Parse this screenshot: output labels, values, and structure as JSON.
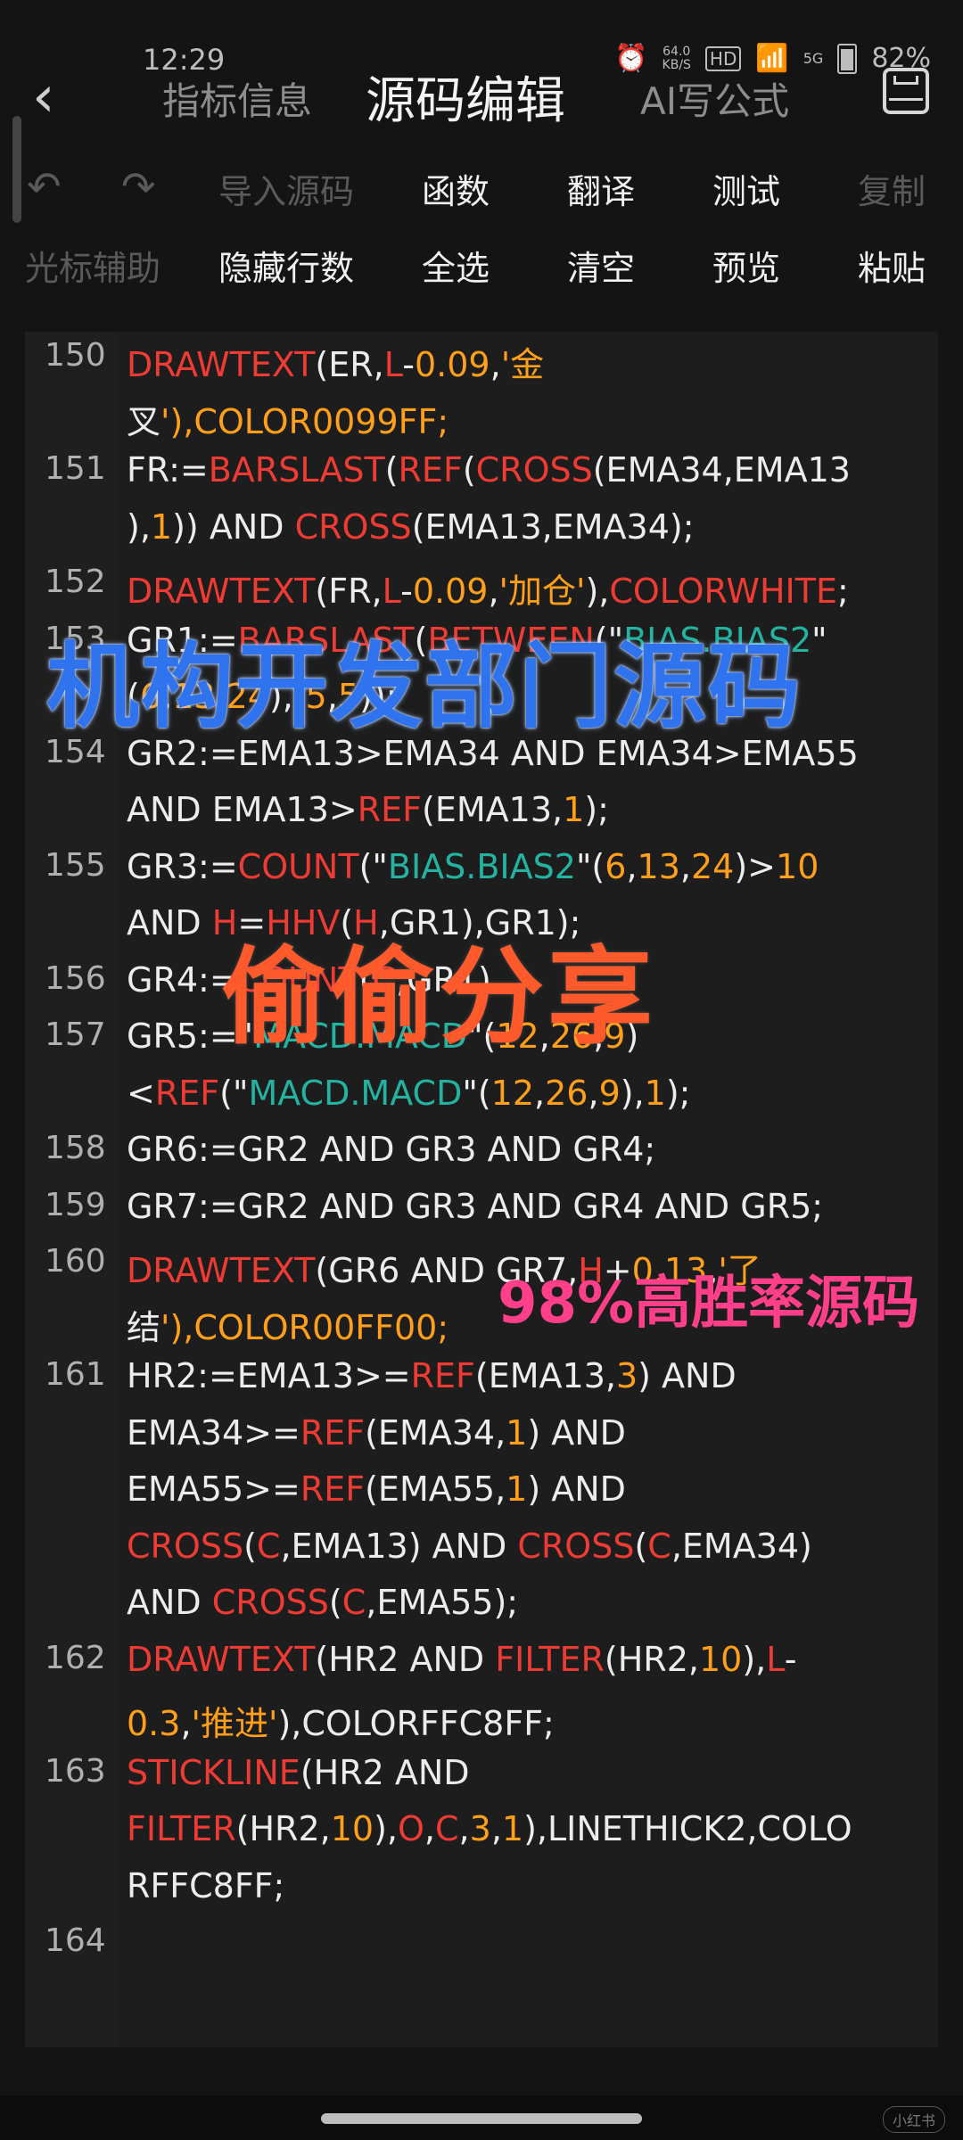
{
  "status": {
    "time": "12:29",
    "net_speed": "64.0",
    "net_unit": "KB/S",
    "signal": "5G",
    "battery": "82%"
  },
  "nav": {
    "back": "‹",
    "tabs": [
      "指标信息",
      "源码编辑",
      "AI写公式"
    ]
  },
  "toolbar": {
    "row1": [
      "导入源码",
      "函数",
      "翻译",
      "测试",
      "复制"
    ],
    "row2": [
      "光标辅助",
      "隐藏行数",
      "全选",
      "清空",
      "预览",
      "粘贴"
    ]
  },
  "code_lines": [
    {
      "ln": "150",
      "text": "DRAWTEXT(ER,L-0.09,'金"
    },
    {
      "ln": "",
      "text": "叉'),COLOR0099FF;"
    },
    {
      "ln": "151",
      "text": "FR:=BARSLAST(REF(CROSS(EMA34,EMA13"
    },
    {
      "ln": "",
      "text": "),1)) AND CROSS(EMA13,EMA34);"
    },
    {
      "ln": "152",
      "text": "DRAWTEXT(FR,L-0.09,'加仓'),COLORWHITE;"
    },
    {
      "ln": "153",
      "text": "GR1:=BARSLAST(BETWEEN(\"BIAS.BIAS2\""
    },
    {
      "ln": "",
      "text": "(6,13,24),-5,5));"
    },
    {
      "ln": "154",
      "text": "GR2:=EMA13>EMA34 AND EMA34>EMA55"
    },
    {
      "ln": "",
      "text": "AND EMA13>REF(EMA13,1);"
    },
    {
      "ln": "155",
      "text": "GR3:=COUNT(\"BIAS.BIAS2\"(6,13,24)>10"
    },
    {
      "ln": "",
      "text": "AND H=HHV(H,GR1),GR1);"
    },
    {
      "ln": "156",
      "text": "GR4:=COUNT(C,GR1)"
    },
    {
      "ln": "157",
      "text": "GR5:=\"MACD.MACD\"(12,26,9)"
    },
    {
      "ln": "",
      "text": "<REF(\"MACD.MACD\"(12,26,9),1);"
    },
    {
      "ln": "158",
      "text": "GR6:=GR2 AND GR3 AND GR4;"
    },
    {
      "ln": "159",
      "text": "GR7:=GR2 AND GR3 AND GR4 AND GR5;"
    },
    {
      "ln": "160",
      "text": "DRAWTEXT(GR6 AND GR7,H+0.13,'了"
    },
    {
      "ln": "",
      "text": "结'),COLOR00FF00;"
    },
    {
      "ln": "161",
      "text": "HR2:=EMA13>=REF(EMA13,3) AND"
    },
    {
      "ln": "",
      "text": "EMA34>=REF(EMA34,1) AND"
    },
    {
      "ln": "",
      "text": "EMA55>=REF(EMA55,1) AND"
    },
    {
      "ln": "",
      "text": "CROSS(C,EMA13) AND CROSS(C,EMA34)"
    },
    {
      "ln": "",
      "text": "AND CROSS(C,EMA55);"
    },
    {
      "ln": "162",
      "text": "DRAWTEXT(HR2 AND FILTER(HR2,10),L-"
    },
    {
      "ln": "",
      "text": "0.3,'推进'),COLORFFC8FF;"
    },
    {
      "ln": "163",
      "text": "STICKLINE(HR2 AND"
    },
    {
      "ln": "",
      "text": "FILTER(HR2,10),O,C,3,1),LINETHICK2,COLO"
    },
    {
      "ln": "",
      "text": "RFFC8FF;"
    },
    {
      "ln": "164",
      "text": ""
    }
  ],
  "overlays": {
    "title": "机构开发部门源码",
    "share": "偷偷分享",
    "rate": "98%高胜率源码"
  },
  "colors": {
    "keyword": "#ee3b33",
    "number": "#ff9f1a",
    "indicator": "#23b3a0",
    "text": "#ececec",
    "background": "#141414"
  },
  "watermark": "小红书"
}
